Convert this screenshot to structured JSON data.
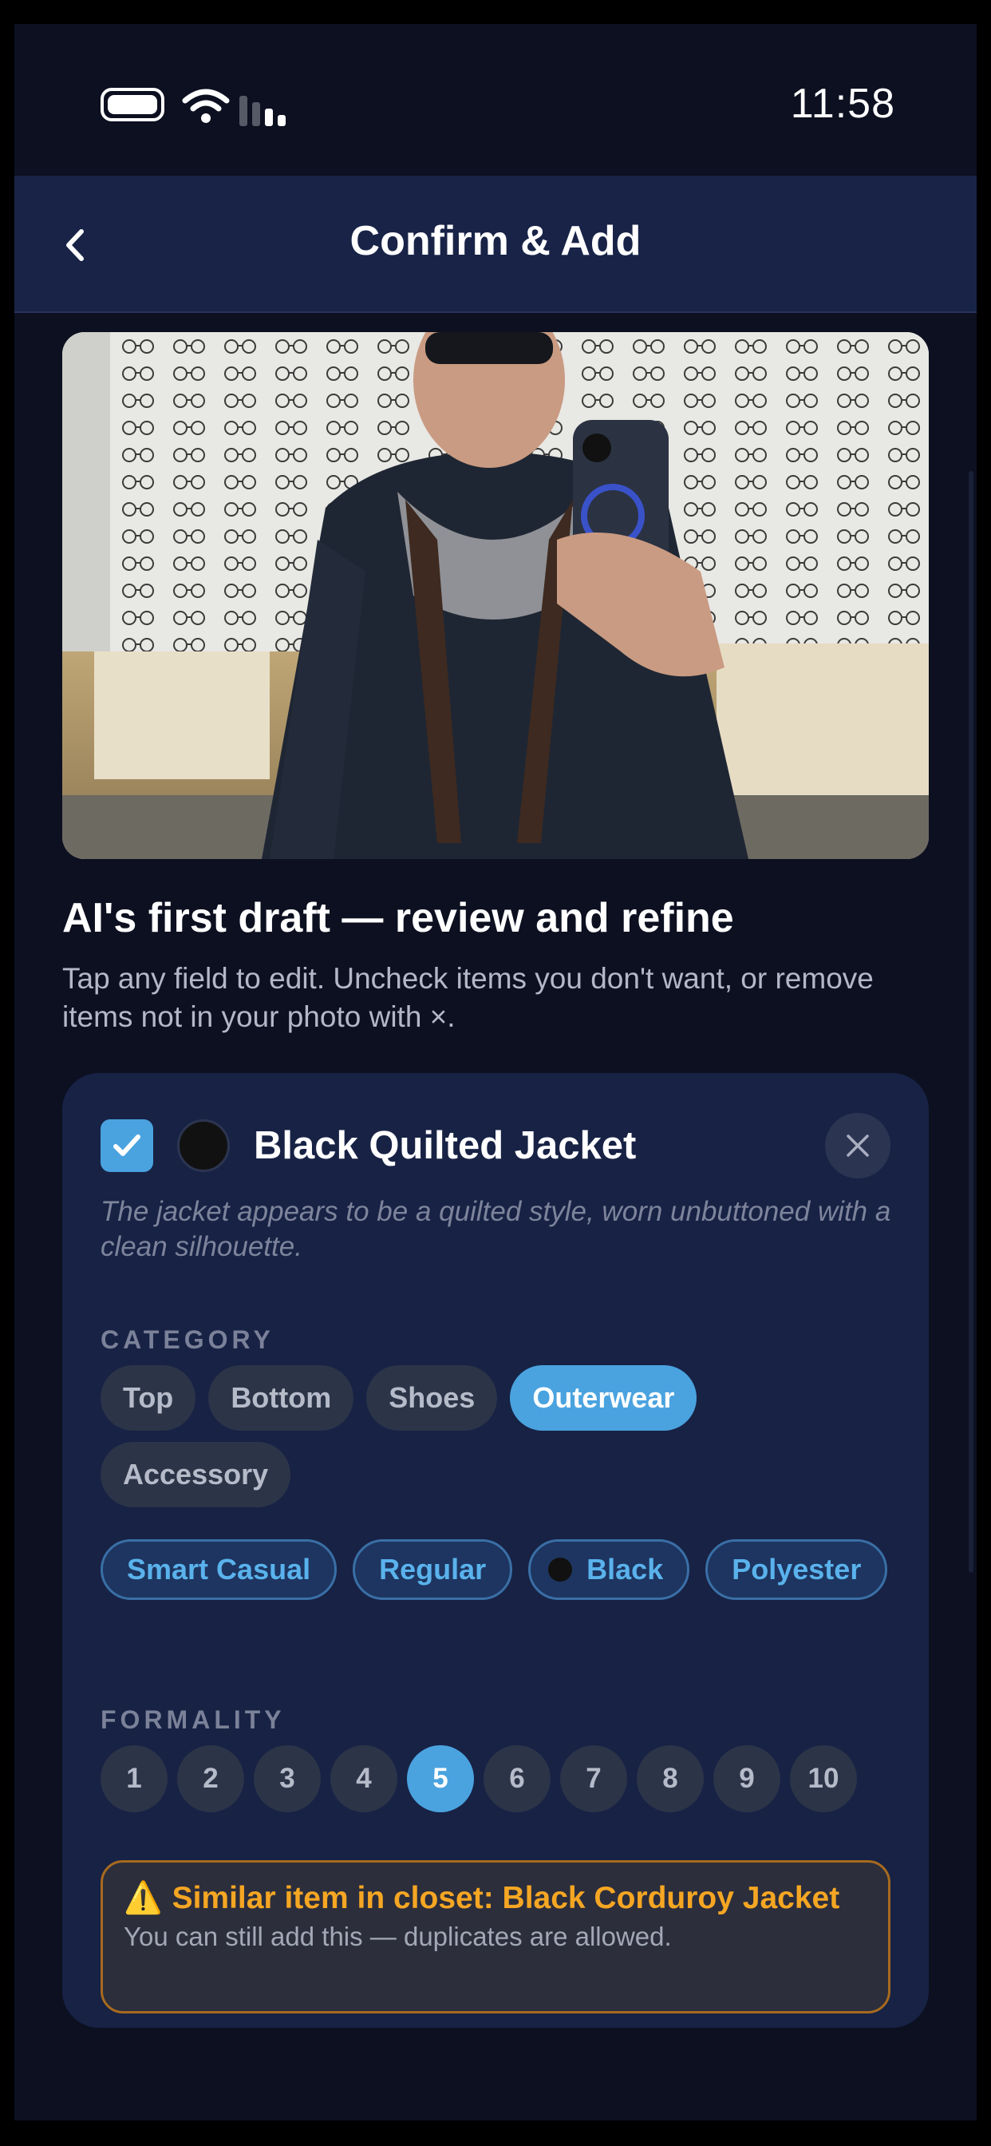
{
  "status_bar": {
    "time": "11:58"
  },
  "nav": {
    "title": "Confirm & Add",
    "back_label": "‹"
  },
  "draft": {
    "heading": "AI's first draft — review and refine",
    "subtitle": "Tap any field to edit. Uncheck items you don't want, or remove items not in your photo with ×."
  },
  "item": {
    "checked": true,
    "color": "#111111",
    "name": "Black Quilted Jacket",
    "description": "The jacket appears to be a quilted style, worn unbuttoned with a clean silhouette.",
    "category_label": "CATEGORY",
    "categories": [
      "Top",
      "Bottom",
      "Shoes",
      "Outerwear",
      "Accessory"
    ],
    "selected_category": "Outerwear",
    "tags": [
      "Smart Casual",
      "Regular",
      "Black",
      "Polyester"
    ],
    "formality_label": "FORMALITY",
    "formality_levels": [
      "1",
      "2",
      "3",
      "4",
      "5",
      "6",
      "7",
      "8",
      "9",
      "10"
    ],
    "selected_formality": "5",
    "warning": {
      "icon": "⚠️",
      "prefix": "Similar item in closet: ",
      "match": "Black Corduroy Jacket",
      "note": "You can still add this — duplicates are allowed."
    }
  },
  "colors": {
    "accent": "#4aa3df",
    "warning": "#f5a623",
    "card": "#172245",
    "background": "#0c1020"
  }
}
